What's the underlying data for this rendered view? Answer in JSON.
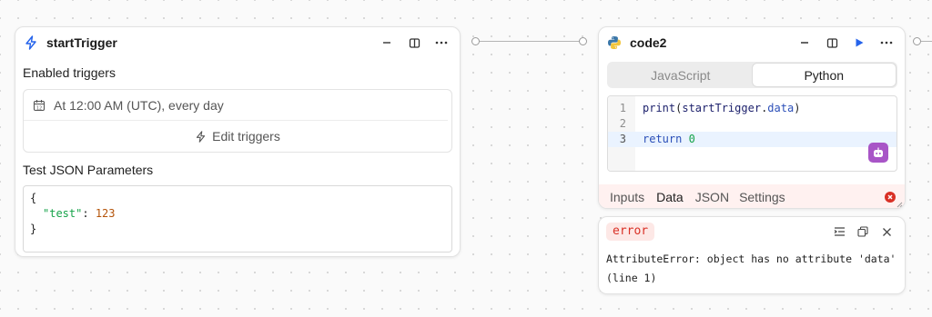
{
  "trigger_node": {
    "title": "startTrigger",
    "enabled_triggers_label": "Enabled triggers",
    "schedule_text": "At 12:00 AM (UTC), every day",
    "edit_triggers_label": "Edit triggers",
    "test_params_label": "Test JSON Parameters",
    "json_lines": [
      "{",
      "\"test\"",
      ": ",
      "123",
      "}"
    ]
  },
  "code_node": {
    "title": "code2",
    "language_tabs": [
      "JavaScript",
      "Python"
    ],
    "active_language": "Python",
    "code_lines": [
      {
        "num": "1",
        "fn": "print",
        "open": "(",
        "obj": "startTrigger",
        "dot": ".",
        "attr": "data",
        "close": ")"
      },
      {
        "num": "2"
      },
      {
        "num": "3",
        "kw": "return",
        "val": "0"
      }
    ],
    "bottom_tabs": [
      "Inputs",
      "Data",
      "JSON",
      "Settings"
    ],
    "active_bottom_tab": "Data"
  },
  "error_panel": {
    "badge": "error",
    "message_line1": "AttributeError: object has no attribute 'data'",
    "message_line2": "(line 1)"
  },
  "colors": {
    "accent_blue": "#2563eb",
    "error_red": "#d93025",
    "json_key_green": "#16a34a",
    "json_number_orange": "#b45309",
    "code_active_line": "#eaf3ff"
  }
}
